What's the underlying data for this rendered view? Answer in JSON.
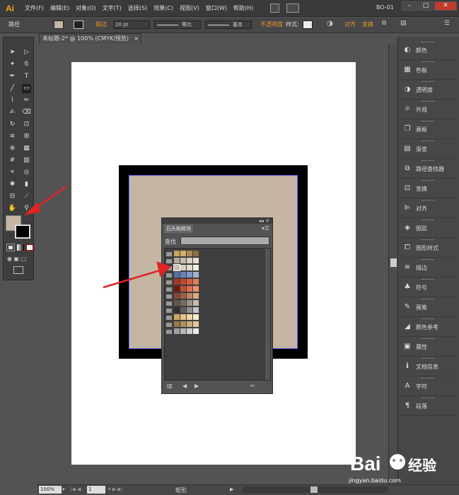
{
  "app": {
    "logo": "Ai",
    "doc_label": "BO-01",
    "menus": [
      "文件(F)",
      "编辑(E)",
      "对象(O)",
      "文字(T)",
      "选择(S)",
      "效果(C)",
      "视图(V)",
      "窗口(W)",
      "帮助(H)"
    ],
    "window_controls": {
      "minimize": "–",
      "maximize": "□",
      "close": "✕"
    }
  },
  "controlbar": {
    "selection_label": "路径",
    "stroke_label": "描边",
    "stroke_weight": "20 pt",
    "profile_label": "等比",
    "brush_label": "基本",
    "opacity_label": "不透明度",
    "style_label": "样式:",
    "align_label": "对齐",
    "transform_label": "变换"
  },
  "document": {
    "tab_title": "未标题-2* @ 100% (CMYK/预览)",
    "tab_close": "×"
  },
  "colors": {
    "fill": "#c4b6a3",
    "accent": "#f7a21b",
    "orange_link": "#e8952a",
    "selection": "#6c6cff"
  },
  "swatch_panel": {
    "title": "石头和砖块",
    "find_label": "查找",
    "rows": [
      [
        "#c8a45c",
        "#d4b06c",
        "#a88a58",
        "#8c6e40"
      ],
      [
        "#b0a898",
        "#c4bcaa",
        "#d8d0c0",
        "#e8e0d0"
      ],
      [
        "#c8c0b0",
        "#d8d0c0",
        "#e4dccc",
        "#f0ece0"
      ],
      [
        "#5870a0",
        "#6c84b4",
        "#8098c4",
        "#a0b4d4"
      ],
      [
        "#a83820",
        "#c04830",
        "#d06040",
        "#e07c58"
      ],
      [
        "#701808",
        "#c05030",
        "#e07050",
        "#f09070"
      ],
      [
        "#804830",
        "#a06048",
        "#c08468",
        "#e0a888"
      ],
      [
        "#605850",
        "#786c60",
        "#a09484",
        "#c8bca8"
      ],
      [
        "#303030",
        "#606060",
        "#909090",
        "#c8c8c8"
      ],
      [
        "#d0a860",
        "#e4c488",
        "#f0d8a8",
        "#f8ecc8"
      ],
      [
        "#987848",
        "#b09060",
        "#c8ac80",
        "#e0c8a0"
      ],
      [
        "#a0a0a0",
        "#b8b8b8",
        "#d0d0d0",
        "#e8e8e8"
      ]
    ]
  },
  "right_panels": [
    {
      "icon": "color-icon",
      "glyph": "◐",
      "label": "颜色"
    },
    {
      "icon": "swatches-icon",
      "glyph": "▦",
      "label": "色板"
    },
    {
      "icon": "transparency-icon",
      "glyph": "◑",
      "label": "透明度"
    },
    {
      "icon": "appearance-icon",
      "glyph": "☼",
      "label": "外观"
    },
    {
      "icon": "artboards-icon",
      "glyph": "❐",
      "label": "画板"
    },
    {
      "icon": "gradient-icon",
      "glyph": "▤",
      "label": "渐变"
    },
    {
      "icon": "pathfinder-icon",
      "glyph": "⧉",
      "label": "路径查找器"
    },
    {
      "icon": "transform-icon",
      "glyph": "⊡",
      "label": "变换"
    },
    {
      "icon": "align-icon",
      "glyph": "⊫",
      "label": "对齐"
    },
    {
      "icon": "layers-icon",
      "glyph": "◈",
      "label": "图层"
    },
    {
      "icon": "graphic-styles-icon",
      "glyph": "⧠",
      "label": "图形样式"
    },
    {
      "icon": "stroke-icon",
      "glyph": "≡",
      "label": "描边"
    },
    {
      "icon": "symbols-icon",
      "glyph": "♣",
      "label": "符号"
    },
    {
      "icon": "brushes-icon",
      "glyph": "✎",
      "label": "画笔"
    },
    {
      "icon": "color-guide-icon",
      "glyph": "◢",
      "label": "颜色参考"
    },
    {
      "icon": "attributes-icon",
      "glyph": "▣",
      "label": "属性"
    },
    {
      "icon": "document-info-icon",
      "glyph": "ℹ",
      "label": "文档信息"
    },
    {
      "icon": "character-icon",
      "glyph": "A",
      "label": "字符"
    },
    {
      "icon": "paragraph-icon",
      "glyph": "¶",
      "label": "段落"
    }
  ],
  "status": {
    "zoom": "100%",
    "page": "1",
    "tool_name": "矩形"
  },
  "watermark": {
    "brand": "Bai",
    "brand_cn": "经验",
    "url": "jingyan.baidu.com"
  }
}
